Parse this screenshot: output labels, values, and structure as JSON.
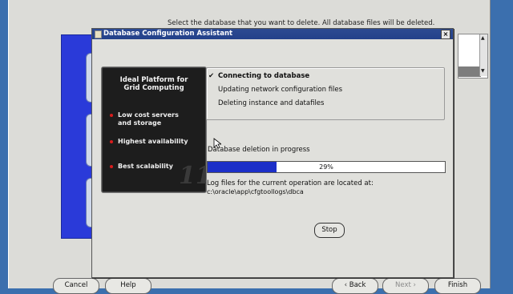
{
  "background_window": {
    "hint_text": "Select the database that you want to delete. All database files will be deleted.",
    "buttons": {
      "cancel": "Cancel",
      "help": "Help",
      "back": "Back",
      "next": "Next",
      "finish": "Finish"
    }
  },
  "dialog": {
    "title": "Database Configuration Assistant",
    "promo": {
      "title_line1": "Ideal Platform for",
      "title_line2": "Grid Computing",
      "bullets": [
        {
          "line1": "Low cost servers",
          "line2": "and storage"
        },
        {
          "line1": "Highest availability"
        },
        {
          "line1": "Best scalability"
        }
      ],
      "mark": "11g"
    },
    "steps": [
      {
        "label": "Connecting to database",
        "status": "active",
        "check": "✔"
      },
      {
        "label": "Updating network configuration files",
        "status": "pending"
      },
      {
        "label": "Deleting instance and datafiles",
        "status": "pending"
      }
    ],
    "progress": {
      "label": "Database deletion in progress",
      "percent": 29,
      "text": "29%"
    },
    "log": {
      "label": "Log files for the current operation are located at:",
      "path": "c:\\oracle\\app\\cfgtoollogs\\dbca"
    },
    "stop_label": "Stop"
  },
  "colors": {
    "desktop": "#3b6fae",
    "titlebar": "#23418a",
    "progress_fill": "#1c2fc8",
    "promo_bg": "#1d1d1d",
    "bullet_dot": "#d91d1d"
  }
}
